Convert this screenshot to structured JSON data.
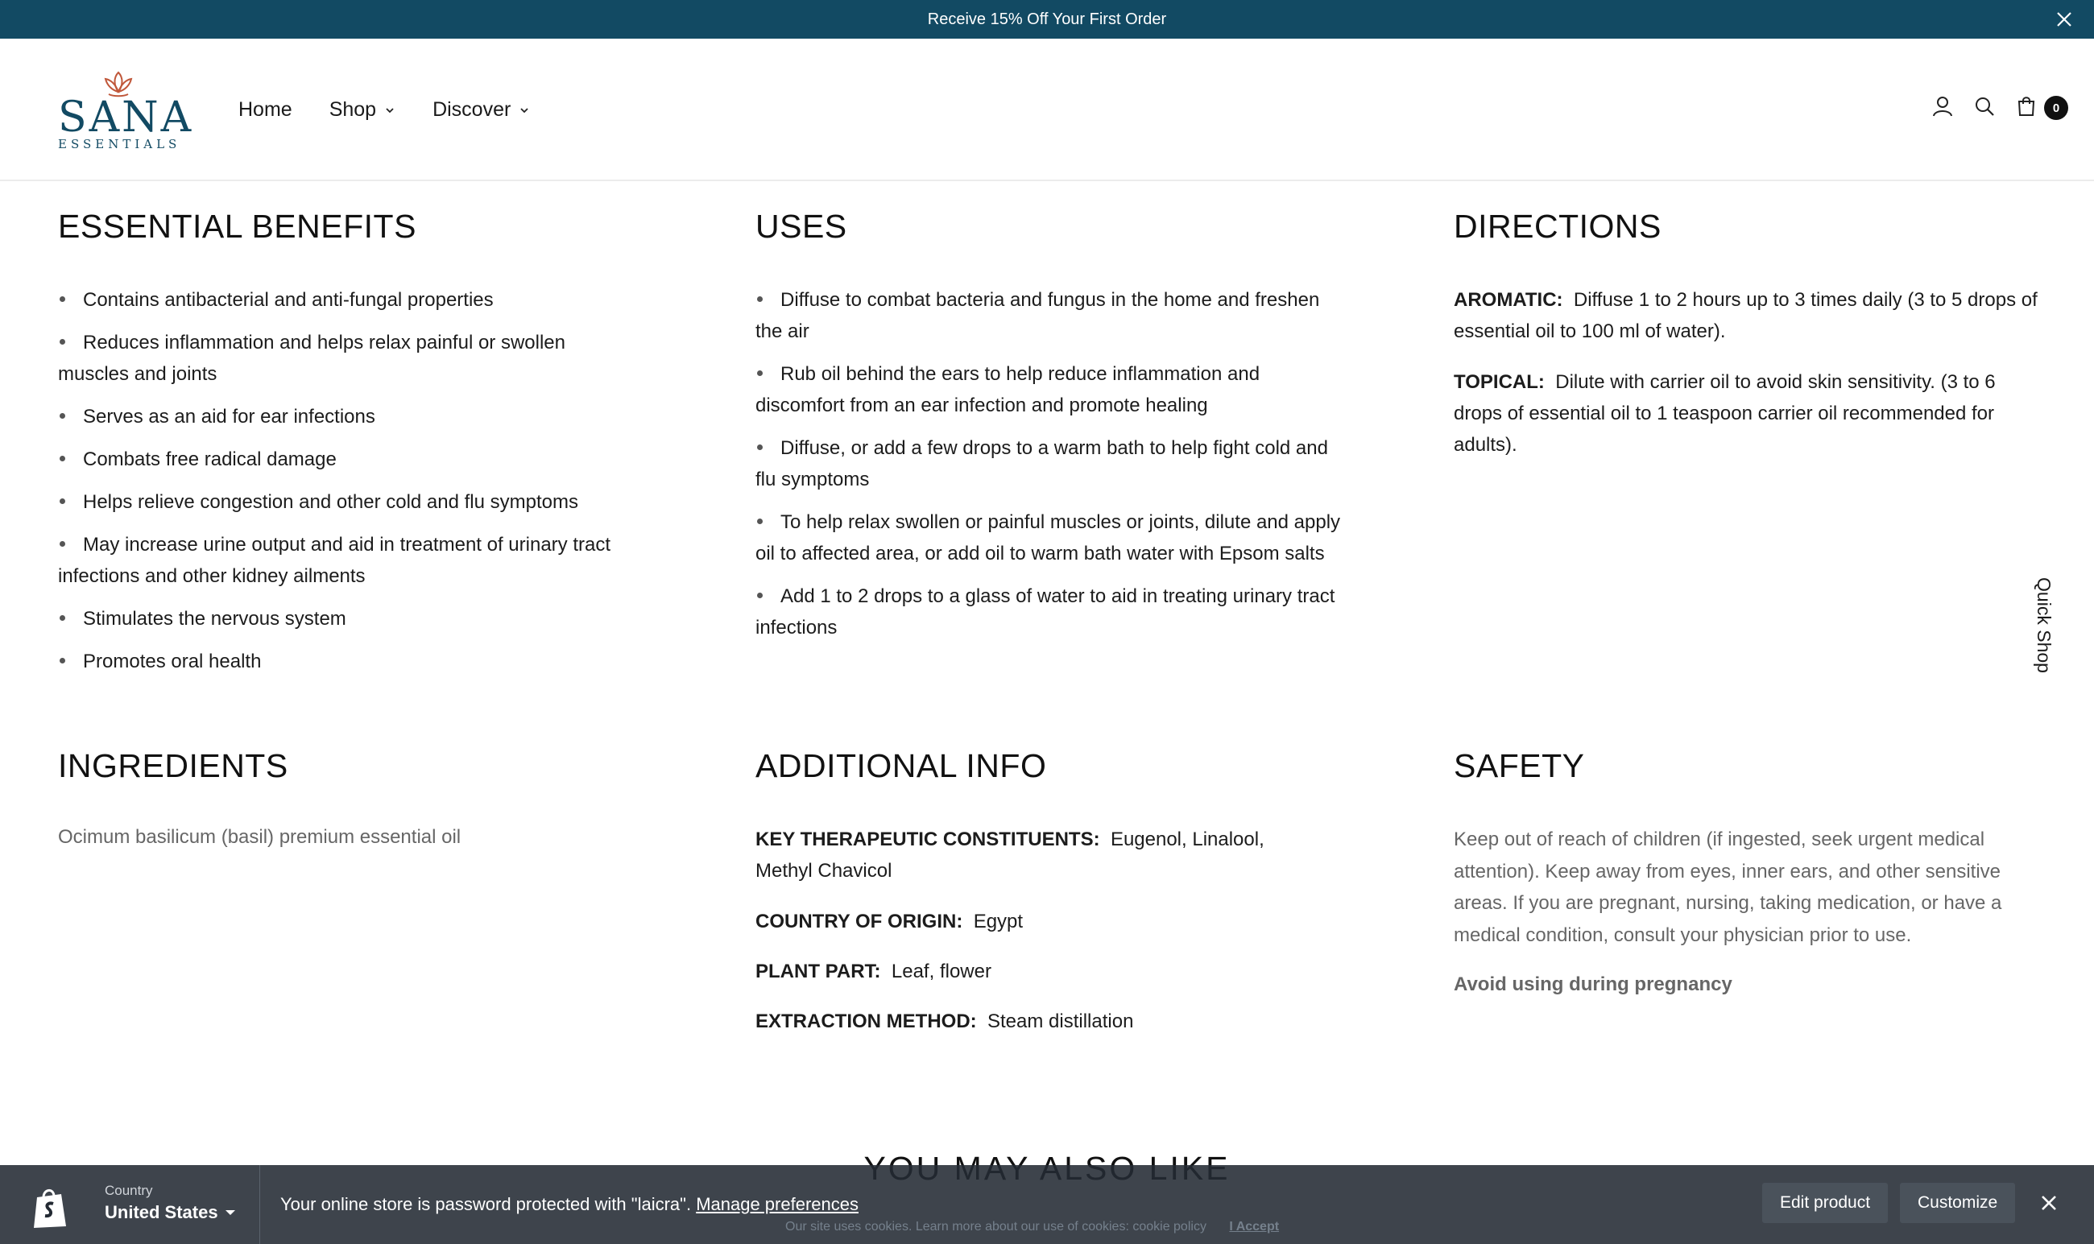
{
  "announcement": {
    "text": "Receive 15% Off Your First Order"
  },
  "logo": {
    "brand": "SANA",
    "sub": "ESSENTIALS"
  },
  "nav": [
    {
      "label": "Home"
    },
    {
      "label": "Shop"
    },
    {
      "label": "Discover"
    }
  ],
  "cart": {
    "count": "0"
  },
  "quick_shop": "Quick Shop",
  "benefits": {
    "title": "ESSENTIAL BENEFITS",
    "items": [
      "Contains antibacterial and anti-fungal properties",
      "Reduces inflammation and helps relax painful or swollen muscles and joints",
      "Serves as an aid for ear infections",
      "Combats free radical damage",
      "Helps relieve congestion and other cold and flu symptoms",
      "May increase urine output and aid in treatment of urinary tract infections and other kidney ailments",
      "Stimulates the nervous system",
      "Promotes oral health"
    ]
  },
  "uses": {
    "title": "USES",
    "items": [
      "Diffuse to combat bacteria and fungus in the home and freshen the air",
      "Rub oil behind the ears to help reduce inflammation and discomfort from an ear infection and promote healing",
      "Diffuse, or add a few drops to a warm bath to help fight cold and flu symptoms",
      "To help relax swollen or painful muscles or joints, dilute and apply oil to affected area, or add oil to warm bath water with Epsom salts",
      "Add 1 to 2 drops to a glass of water to aid in treating urinary tract infections"
    ]
  },
  "directions": {
    "title": "DIRECTIONS",
    "aromatic_label": "AROMATIC:",
    "aromatic_text": "Diffuse 1 to 2 hours up to 3 times daily (3 to 5 drops of essential oil to 100 ml of water).",
    "topical_label": "TOPICAL:",
    "topical_text": "Dilute with carrier oil to avoid skin sensitivity. (3 to 6 drops of essential oil to 1 teaspoon carrier oil recommended for adults)."
  },
  "ingredients": {
    "title": "INGREDIENTS",
    "text": "Ocimum basilicum (basil) premium essential oil"
  },
  "additional": {
    "title": "ADDITIONAL INFO",
    "constituents_label": "KEY THERAPEUTIC CONSTITUENTS:",
    "constituents": "Eugenol, Linalool, Methyl Chavicol",
    "origin_label": "COUNTRY OF ORIGIN:",
    "origin": "Egypt",
    "plant_label": "PLANT PART:",
    "plant": "Leaf, flower",
    "extraction_label": "EXTRACTION METHOD:",
    "extraction": "Steam distillation"
  },
  "safety": {
    "title": "SAFETY",
    "text": "Keep out of reach of children (if ingested, seek urgent medical attention). Keep away from eyes, inner ears, and other sensitive areas. If you are pregnant, nursing, taking medication, or have a medical condition, consult your physician prior to use.",
    "warning": "Avoid using during pregnancy"
  },
  "also_like": {
    "title": "YOU MAY ALSO LIKE"
  },
  "cookie": {
    "text": "Our site uses cookies. Learn more about our use of cookies: cookie policy",
    "accept": "I Accept"
  },
  "adminbar": {
    "country_label": "Country",
    "country_value": "United States",
    "message": "Your online store is password protected with \"laicra\".",
    "manage_link": "Manage preferences",
    "edit_product": "Edit product",
    "customize": "Customize"
  },
  "colors": {
    "announcement_bg": "#124a63",
    "brand": "#124a63",
    "logo_accent": "#c0573a",
    "admin_bar": "#232a33"
  }
}
